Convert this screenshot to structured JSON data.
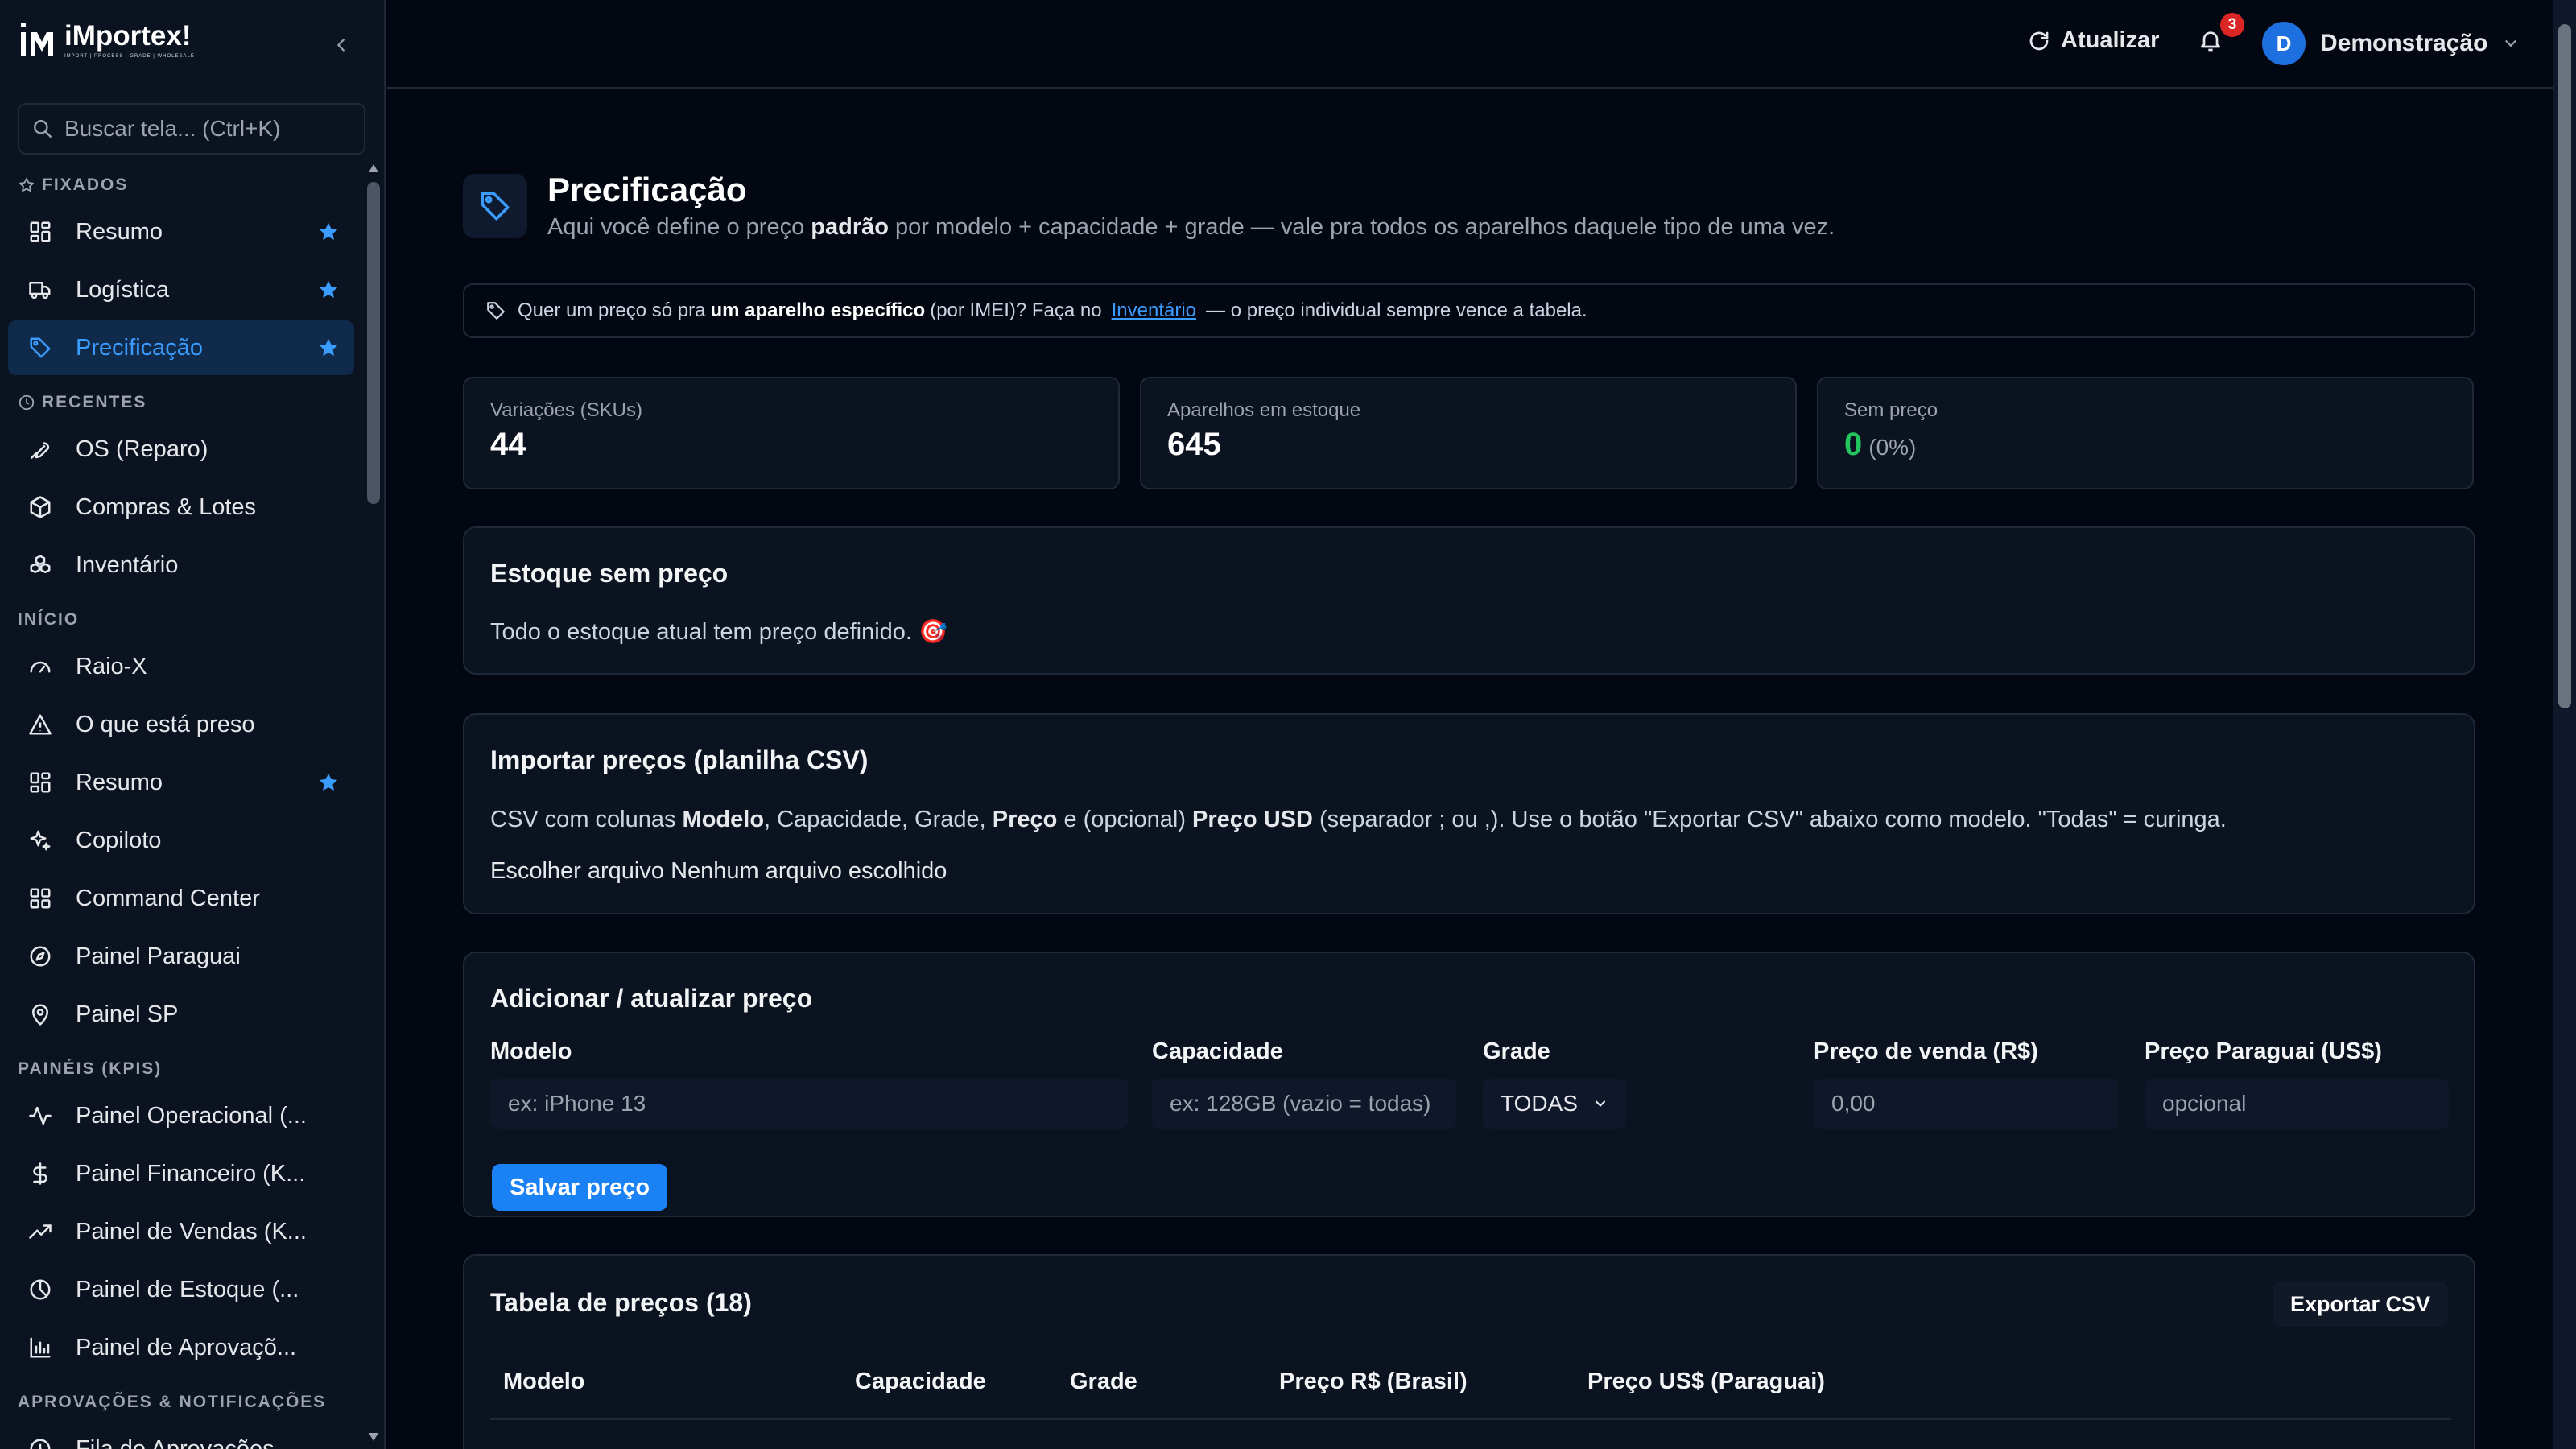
{
  "app": {
    "name": "iMportex!",
    "tagline": "IMPORT | PROCESS | GRADE | WHOLESALE"
  },
  "search": {
    "placeholder": "Buscar tela... (Ctrl+K)"
  },
  "sidebar": {
    "sections": {
      "pinned": "FIXADOS",
      "recent": "RECENTES",
      "start": "INÍCIO",
      "kpis": "PAINÉIS (KPIS)",
      "approvals": "APROVAÇÕES & NOTIFICAÇÕES"
    },
    "pinned": [
      {
        "label": "Resumo",
        "icon": "grid-icon",
        "starred": true
      },
      {
        "label": "Logística",
        "icon": "truck-icon",
        "starred": true
      },
      {
        "label": "Precificação",
        "icon": "tag-icon",
        "starred": true,
        "active": true
      }
    ],
    "recent": [
      {
        "label": "OS (Reparo)",
        "icon": "wrench-icon"
      },
      {
        "label": "Compras & Lotes",
        "icon": "package-icon"
      },
      {
        "label": "Inventário",
        "icon": "boxes-icon"
      }
    ],
    "start": [
      {
        "label": "Raio-X",
        "icon": "gauge-icon"
      },
      {
        "label": "O que está preso",
        "icon": "warning-icon"
      },
      {
        "label": "Resumo",
        "icon": "grid-icon",
        "starred": true
      },
      {
        "label": "Copiloto",
        "icon": "sparkles-icon"
      },
      {
        "label": "Command Center",
        "icon": "grid-icon"
      },
      {
        "label": "Painel Paraguai",
        "icon": "compass-icon"
      },
      {
        "label": "Painel SP",
        "icon": "map-pin-icon"
      }
    ],
    "kpis": [
      {
        "label": "Painel Operacional (...",
        "icon": "activity-icon"
      },
      {
        "label": "Painel Financeiro (K...",
        "icon": "dollar-icon"
      },
      {
        "label": "Painel de Vendas (K...",
        "icon": "trending-up-icon"
      },
      {
        "label": "Painel de Estoque (...",
        "icon": "pie-icon"
      },
      {
        "label": "Painel de Aprovaçõ...",
        "icon": "bar-chart-icon"
      }
    ],
    "approvals": [
      {
        "label": "Fila de Aprovações",
        "icon": "clock-icon"
      }
    ]
  },
  "topbar": {
    "refresh_label": "Atualizar",
    "notifications_count": "3",
    "user_initial": "D",
    "user_name": "Demonstração"
  },
  "page": {
    "title": "Precificação",
    "subtitle_pre": "Aqui você define o preço ",
    "subtitle_bold": "padrão",
    "subtitle_post": " por modelo + capacidade + grade — vale pra todos os aparelhos daquele tipo de uma vez.",
    "tip_pre": "Quer um preço só pra",
    "tip_bold": "um aparelho específico",
    "tip_mid": "(por IMEI)? Faça no",
    "tip_link": "Inventário",
    "tip_post": "— o preço individual sempre vence a tabela."
  },
  "stats": [
    {
      "label": "Variações (SKUs)",
      "value": "44"
    },
    {
      "label": "Aparelhos em estoque",
      "value": "645"
    },
    {
      "label": "Sem preço",
      "value": "0",
      "pct": "(0%)"
    }
  ],
  "no_price": {
    "title": "Estoque sem preço",
    "text": "Todo o estoque atual tem preço definido. 🎯"
  },
  "import": {
    "title": "Importar preços (planilha CSV)",
    "d1": "CSV com colunas ",
    "d2": "Modelo",
    "d3": ", Capacidade, Grade, ",
    "d4": "Preço",
    "d5": " e (opcional) ",
    "d6": "Preço USD",
    "d7": " (separador ; ou ,). Use o botão \"Exportar CSV\" abaixo como modelo. \"Todas\" = curinga.",
    "file_button": "Escolher arquivo",
    "file_status": "Nenhum arquivo escolhido"
  },
  "form": {
    "title": "Adicionar / atualizar preço",
    "model_label": "Modelo",
    "model_placeholder": "ex: iPhone 13",
    "capacity_label": "Capacidade",
    "capacity_placeholder": "ex: 128GB (vazio = todas)",
    "grade_label": "Grade",
    "grade_value": "TODAS",
    "price_label": "Preço de venda (R$)",
    "price_placeholder": "0,00",
    "py_label": "Preço Paraguai (US$)",
    "py_placeholder": "opcional",
    "save_label": "Salvar preço"
  },
  "table": {
    "title": "Tabela de preços (18)",
    "export_label": "Exportar CSV",
    "columns": [
      "Modelo",
      "Capacidade",
      "Grade",
      "Preço R$ (Brasil)",
      "Preço US$ (Paraguai)"
    ]
  },
  "colors": {
    "accent": "#1a82f5",
    "active_bg": "#0f2a4a",
    "star": "#3b9cff",
    "success": "#22c55e",
    "badge": "#dc2626"
  }
}
